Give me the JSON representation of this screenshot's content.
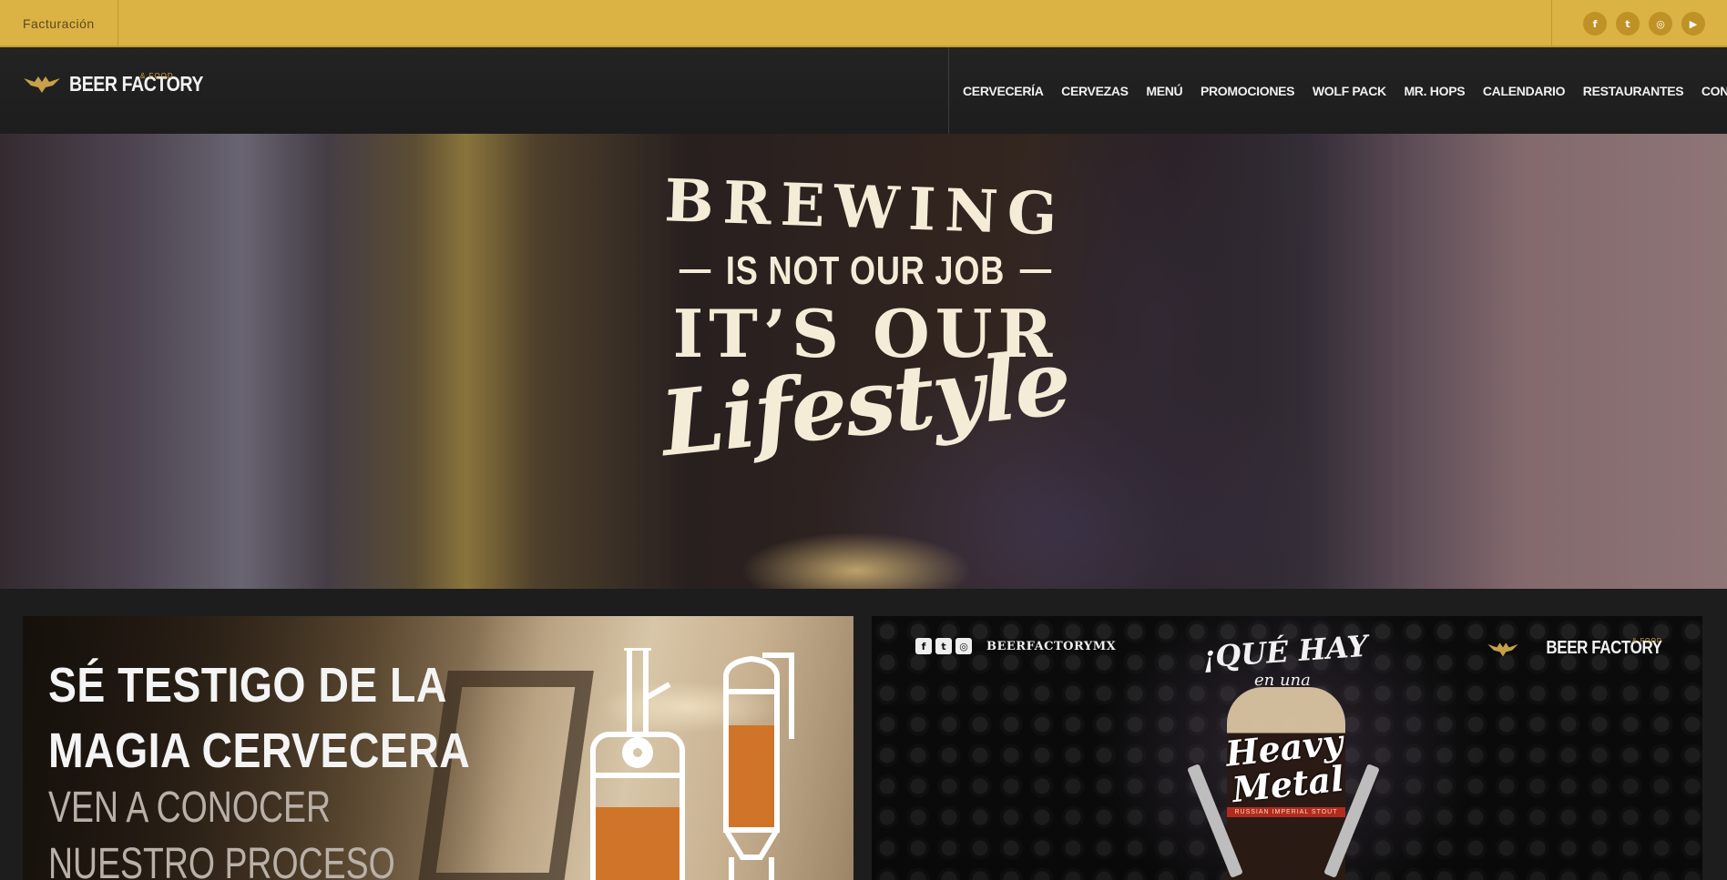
{
  "topbar": {
    "link_label": "Facturación",
    "social": [
      {
        "icon": "facebook-icon",
        "glyph": "f"
      },
      {
        "icon": "twitter-icon",
        "glyph": "t"
      },
      {
        "icon": "instagram-icon",
        "glyph": "◎"
      },
      {
        "icon": "youtube-icon",
        "glyph": "▶"
      }
    ]
  },
  "header": {
    "logo_text": "BEER FACTORY",
    "logo_sub": "& FOOD",
    "nav": [
      "CERVECERÍA",
      "CERVEZAS",
      "MENÚ",
      "PROMOCIONES",
      "WOLF PACK",
      "MR. HOPS",
      "CALENDARIO",
      "RESTAURANTES",
      "CONTACTO"
    ]
  },
  "hero": {
    "line1": "BREWING",
    "line2": "IS NOT OUR JOB",
    "line3": "IT’S OUR",
    "line4": "Lifestyle"
  },
  "cards": {
    "left": {
      "title_line1": "SÉ TESTIGO DE LA",
      "title_line2": "MAGIA CERVECERA",
      "sub_line1": "VEN A CONOCER",
      "sub_line2": "NUESTRO PROCESO"
    },
    "right": {
      "handle": "BEERFACTORYMX",
      "logo_text": "BEER FACTORY",
      "logo_sub": "& FOOD",
      "headline": "¡QUÉ HAY",
      "subheadline": "en una",
      "beer_name_line1": "Heavy",
      "beer_name_line2": "Metal",
      "beer_style": "RUSSIAN IMPERIAL STOUT"
    }
  },
  "colors": {
    "topbar": "#dbb244",
    "accent_gold": "#c09225",
    "header_bg": "#232323",
    "tank_orange": "#d0742a"
  }
}
